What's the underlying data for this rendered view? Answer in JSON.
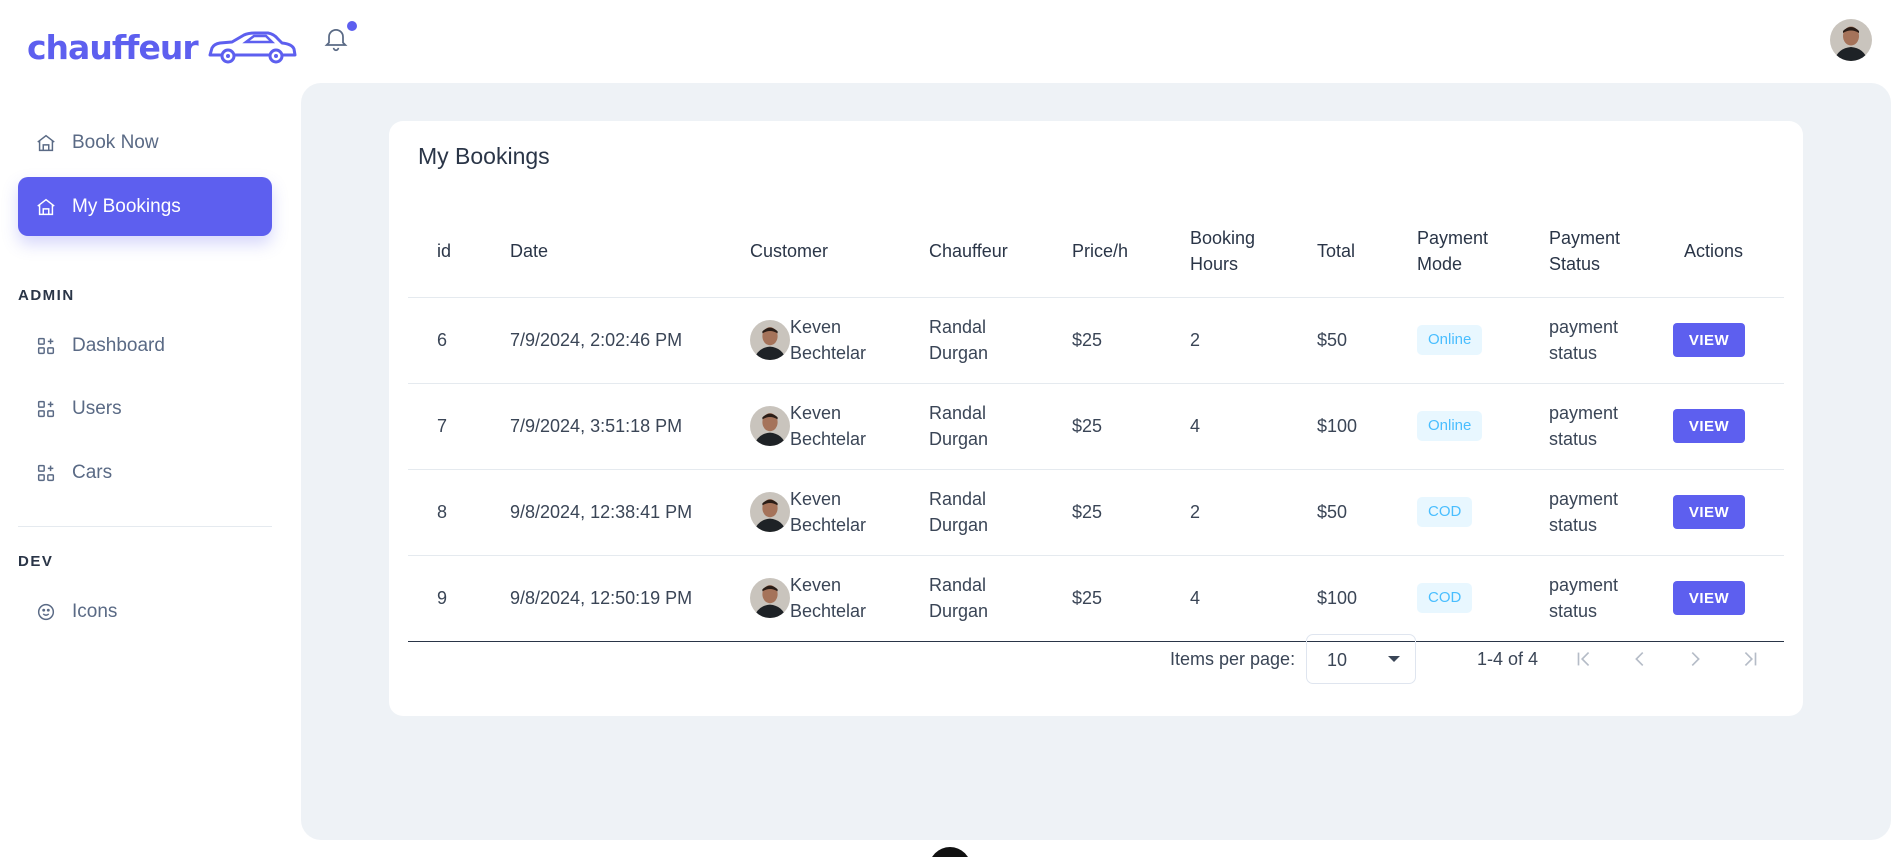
{
  "brand": {
    "name": "chauffeur"
  },
  "sidebar": {
    "items": [
      {
        "label": "Book Now",
        "icon": "home-icon"
      },
      {
        "label": "My Bookings",
        "icon": "home-icon",
        "active": true
      }
    ],
    "admin_heading": "ADMIN",
    "admin_items": [
      {
        "label": "Dashboard",
        "icon": "apps-plus-icon"
      },
      {
        "label": "Users",
        "icon": "apps-plus-icon"
      },
      {
        "label": "Cars",
        "icon": "apps-plus-icon"
      }
    ],
    "dev_heading": "DEV",
    "dev_items": [
      {
        "label": "Icons",
        "icon": "mood-happy-icon"
      }
    ]
  },
  "colors": {
    "accent": "#5d5fef",
    "badge_bg": "#e8f7ff",
    "badge_text": "#49beff",
    "main_bg": "#eef2f6"
  },
  "bookings": {
    "title": "My Bookings",
    "columns": [
      "id",
      "Date",
      "Customer",
      "Chauffeur",
      "Price/h",
      "Booking Hours",
      "Total",
      "Payment Mode",
      "Payment Status",
      "Actions"
    ],
    "rows": [
      {
        "id": "6",
        "date": "7/9/2024, 2:02:46 PM",
        "customer": "Keven Bechtelar",
        "chauffeur": "Randal Durgan",
        "price": "$25",
        "hours": "2",
        "total": "$50",
        "mode": "Online",
        "status": "payment status",
        "action": "VIEW"
      },
      {
        "id": "7",
        "date": "7/9/2024, 3:51:18 PM",
        "customer": "Keven Bechtelar",
        "chauffeur": "Randal Durgan",
        "price": "$25",
        "hours": "4",
        "total": "$100",
        "mode": "Online",
        "status": "payment status",
        "action": "VIEW"
      },
      {
        "id": "8",
        "date": "9/8/2024, 12:38:41 PM",
        "customer": "Keven Bechtelar",
        "chauffeur": "Randal Durgan",
        "price": "$25",
        "hours": "2",
        "total": "$50",
        "mode": "COD",
        "status": "payment status",
        "action": "VIEW"
      },
      {
        "id": "9",
        "date": "9/8/2024, 12:50:19 PM",
        "customer": "Keven Bechtelar",
        "chauffeur": "Randal Durgan",
        "price": "$25",
        "hours": "4",
        "total": "$100",
        "mode": "COD",
        "status": "payment status",
        "action": "VIEW"
      }
    ]
  },
  "pagination": {
    "items_per_page_label": "Items per page:",
    "items_per_page_value": "10",
    "range_label": "1-4 of 4"
  }
}
